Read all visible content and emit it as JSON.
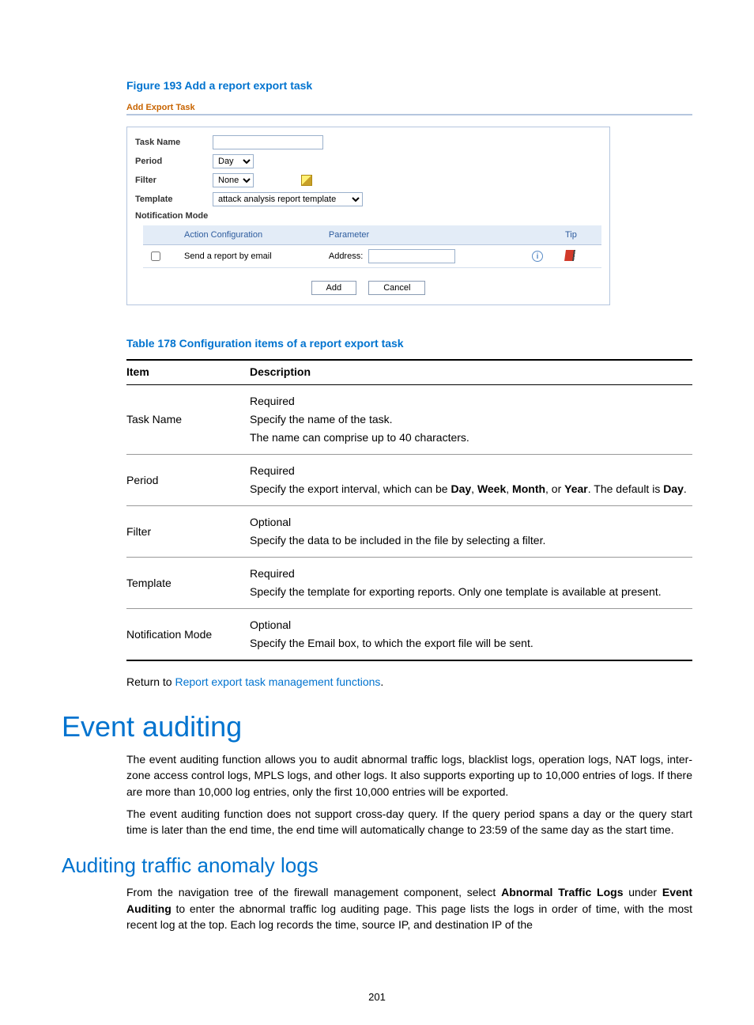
{
  "figure": {
    "title": "Figure 193 Add a report export task"
  },
  "screenshot": {
    "title": "Add Export Task",
    "labels": {
      "taskName": "Task Name",
      "period": "Period",
      "filter": "Filter",
      "template": "Template",
      "notificationMode": "Notification Mode"
    },
    "values": {
      "period": "Day",
      "filter": "None",
      "template": "attack analysis report template"
    },
    "notifTable": {
      "headers": {
        "action": "Action Configuration",
        "param": "Parameter",
        "tip": "Tip"
      },
      "row": {
        "action": "Send a report by email",
        "paramLabel": "Address:"
      }
    },
    "buttons": {
      "add": "Add",
      "cancel": "Cancel"
    }
  },
  "tableTitle": "Table 178 Configuration items of a report export task",
  "cfg": {
    "headers": {
      "item": "Item",
      "desc": "Description"
    },
    "rows": [
      {
        "item": "Task Name",
        "desc": [
          "Required",
          "Specify the name of the task.",
          "The name can comprise up to 40 characters."
        ]
      },
      {
        "item": "Period",
        "desc": [
          "Required",
          "Specify the export interval, which can be <b>Day</b>, <b>Week</b>, <b>Month</b>, or <b>Year</b>. The default is <b>Day</b>."
        ]
      },
      {
        "item": "Filter",
        "desc": [
          "Optional",
          "Specify the data to be included in the file by selecting a filter."
        ]
      },
      {
        "item": "Template",
        "desc": [
          "Required",
          "Specify the template for exporting reports. Only one template is available at present."
        ]
      },
      {
        "item": "Notification Mode",
        "desc": [
          "Optional",
          "Specify the Email box, to which the export file will be sent."
        ]
      }
    ]
  },
  "return": {
    "prefix": "Return to ",
    "link": "Report export task management functions",
    "suffix": "."
  },
  "h1": "Event auditing",
  "p1": "The event auditing function allows you to audit abnormal traffic logs, blacklist logs, operation logs, NAT logs, inter-zone access control logs, MPLS logs, and other logs. It also supports exporting up to 10,000 entries of logs. If there are more than 10,000 log entries, only the first 10,000 entries will be exported.",
  "p2": "The event auditing function does not support cross-day query. If the query period spans a day or the query start time is later than the end time, the end time will automatically change to 23:59 of the same day as the start time.",
  "h2": "Auditing traffic anomaly logs",
  "p3": "From the navigation tree of the firewall management component, select <b>Abnormal Traffic Logs</b> under <b>Event Auditing</b> to enter the abnormal traffic log auditing page. This page lists the logs in order of time, with the most recent log at the top. Each log records the time, source IP, and destination IP of the",
  "pageNumber": "201"
}
